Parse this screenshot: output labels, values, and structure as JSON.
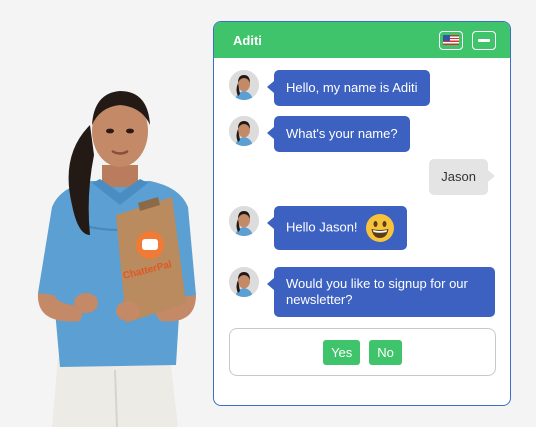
{
  "widget": {
    "title": "Aditi",
    "language_icon": "us-flag-icon",
    "minimize_icon": "minus-icon"
  },
  "branding": {
    "clipboard_logo": "ChatterPal"
  },
  "messages": [
    {
      "from": "bot",
      "text": "Hello, my name is Aditi"
    },
    {
      "from": "bot",
      "text": "What's your name?"
    },
    {
      "from": "user",
      "text": "Jason"
    },
    {
      "from": "bot",
      "text": "Hello Jason!",
      "emoji": "grinning-face-emoji"
    },
    {
      "from": "bot",
      "text": "Would you like to signup for our newsletter?"
    }
  ],
  "options": {
    "yes": "Yes",
    "no": "No"
  },
  "colors": {
    "header": "#3fc46b",
    "bot_bubble": "#3c61c1",
    "user_bubble": "#e4e4e4",
    "button": "#3fc46b",
    "border": "#3b6fc7"
  }
}
